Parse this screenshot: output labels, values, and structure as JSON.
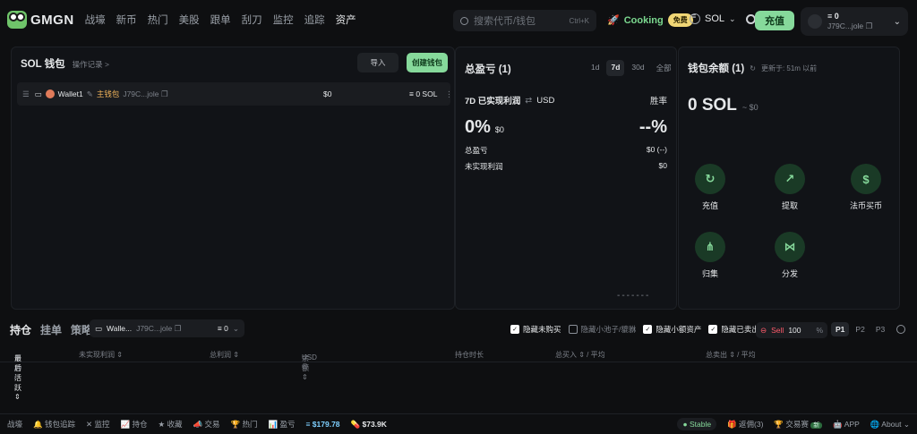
{
  "header": {
    "logo_text": "GMGN",
    "nav": [
      "战壕",
      "新币",
      "热门",
      "美股",
      "跟单",
      "刮刀",
      "监控",
      "追踪",
      "资产"
    ],
    "nav_active_index": 8,
    "search_placeholder": "搜索代币/钱包",
    "search_shortcut": "Ctrl+K",
    "cooking_label": "Cooking",
    "cooking_badge": "免费",
    "chain_label": "SOL",
    "deposit_button": "充值",
    "wallet_balance": "0",
    "wallet_address": "J79C...jole"
  },
  "wallet_panel": {
    "title": "SOL 钱包",
    "history_link": "操作记录 >",
    "import_button": "导入",
    "create_button": "创建钱包",
    "row": {
      "name": "Wallet1",
      "main_tag": "主钱包",
      "address": "J79C...jole",
      "usd_value": "$0",
      "sol_value": "0 SOL"
    }
  },
  "pnl_panel": {
    "title": "总盈亏 (1)",
    "ranges": [
      "1d",
      "7d",
      "30d",
      "全部"
    ],
    "active_range": "7d",
    "realized_label": "7D 已实现利润",
    "currency": "USD",
    "winrate_label": "胜率",
    "pct": "0%",
    "pct_usd": "$0",
    "winrate": "--%",
    "total_pnl_label": "总盈亏",
    "total_pnl_value": "$0 (--)",
    "unrealized_label": "未实现利润",
    "unrealized_value": "$0",
    "dash_line": "-------"
  },
  "balance_panel": {
    "title": "钱包余额 (1)",
    "updated": "更新于: 51m 以前",
    "balance": "0 SOL",
    "balance_usd": "~ $0",
    "actions": [
      "充值",
      "提取",
      "法币买币",
      "归集",
      "分发"
    ]
  },
  "holdings": {
    "tabs": [
      "持仓",
      "挂单",
      "策略"
    ],
    "active_tab": "持仓",
    "wallet_name": "Walle...",
    "wallet_address": "J79C...jole",
    "wallet_count": "0",
    "filters": [
      {
        "label": "隐藏未购买",
        "checked": true
      },
      {
        "label": "隐藏小池子/貔貅",
        "checked": false
      },
      {
        "label": "隐藏小额资产",
        "checked": true
      },
      {
        "label": "隐藏已卖出",
        "checked": true
      }
    ],
    "sell_label": "Sell",
    "sell_value": "100",
    "sell_unit": "%",
    "presets": [
      "P1",
      "P2",
      "P3"
    ],
    "active_preset": "P1",
    "columns": {
      "token": "币种 /",
      "last_active": "最后活跃 ⇕",
      "unrealized": "未实现利润 ⇕",
      "total_profit": "总利润 ⇕",
      "balance": "余额 ⇕",
      "balance_unit": "USD ◎",
      "hold_time": "持仓时长",
      "total_buy": "总买入 ⇕ / 平均",
      "total_sell": "总卖出 ⇕ / 平均"
    }
  },
  "footer": {
    "items": [
      "战壕",
      "钱包追踪",
      "监控",
      "持仓",
      "收藏",
      "交易",
      "热门",
      "盈亏"
    ],
    "sol_price": "$179.78",
    "vol": "$73.9K",
    "stable": "Stable",
    "rebate": "返佣(3)",
    "contest": "交易赛",
    "contest_badge": "新",
    "app": "APP",
    "about": "About"
  }
}
